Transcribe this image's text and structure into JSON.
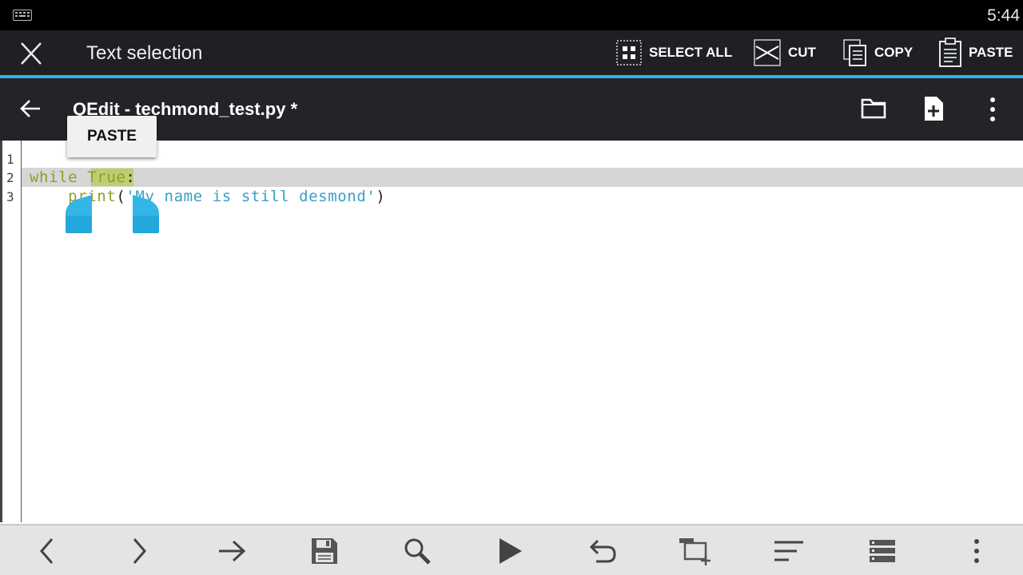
{
  "status_bar": {
    "time": "5:44",
    "keyboard_icon": "keyboard-icon"
  },
  "action_mode": {
    "title": "Text selection",
    "close_icon": "close-icon",
    "actions": [
      {
        "label": "SELECT ALL",
        "icon": "select-all-icon"
      },
      {
        "label": "CUT",
        "icon": "cut-icon"
      },
      {
        "label": "COPY",
        "icon": "copy-icon"
      },
      {
        "label": "PASTE",
        "icon": "paste-icon"
      }
    ],
    "accent_color": "#33b5e5"
  },
  "app_bar": {
    "title": "QEdit - techmond_test.py *",
    "icons": [
      "back-arrow-icon",
      "folder-icon",
      "new-file-icon",
      "overflow-menu-icon"
    ]
  },
  "editor": {
    "line_numbers": [
      "1",
      "2",
      "3"
    ],
    "lines": [
      {
        "tokens": []
      },
      {
        "tokens": [
          "while",
          " ",
          "True",
          ":"
        ]
      },
      {
        "tokens": [
          "    ",
          "print",
          "(",
          "'My name is still desmond'",
          ")"
        ]
      }
    ],
    "selected_text": "True",
    "selection_color": "#b4c94e"
  },
  "paste_popup": {
    "label": "PASTE"
  },
  "bottom_toolbar": {
    "icons": [
      "chevron-left-icon",
      "chevron-right-icon",
      "arrow-right-icon",
      "save-icon",
      "search-icon",
      "run-icon",
      "undo-icon",
      "add-tab-icon",
      "format-align-icon",
      "list-icon",
      "more-icon"
    ]
  }
}
